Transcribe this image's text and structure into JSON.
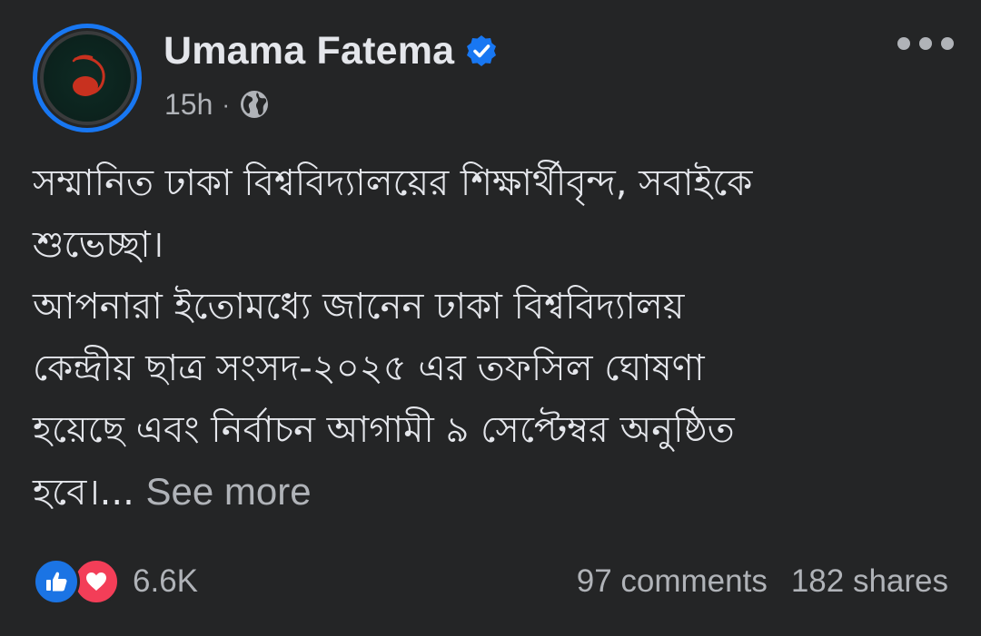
{
  "author": {
    "name": "Umama Fatema",
    "verified": true,
    "avatar_icon": "profile-avatar-red-swirl"
  },
  "meta": {
    "time": "15h",
    "separator": "·",
    "audience_icon": "globe-icon"
  },
  "post": {
    "lines": [
      "সম্মানিত ঢাকা বিশ্ববিদ্যালয়ের শিক্ষার্থীবৃন্দ, সবাইকে",
      "শুভেচ্ছা।",
      "আপনারা ইতোমধ্যে জানেন ঢাকা বিশ্ববিদ্যালয়",
      "কেন্দ্রীয় ছাত্র সংসদ-২০২৫ এর তফসিল ঘোষণা",
      "হয়েছে এবং নির্বাচন আগামী ৯ সেপ্টেম্বর অনুষ্ঠিত",
      "হবে।..."
    ],
    "see_more": "See more"
  },
  "footer": {
    "reaction_count": "6.6K",
    "reaction_icons": [
      "like-icon",
      "love-icon"
    ],
    "comments": "97 comments",
    "shares": "182 shares"
  },
  "colors": {
    "background": "#242526",
    "primary_text": "#e4e6eb",
    "secondary_text": "#b0b3b8",
    "brand_blue": "#1877f2",
    "love_red": "#f33e58"
  }
}
